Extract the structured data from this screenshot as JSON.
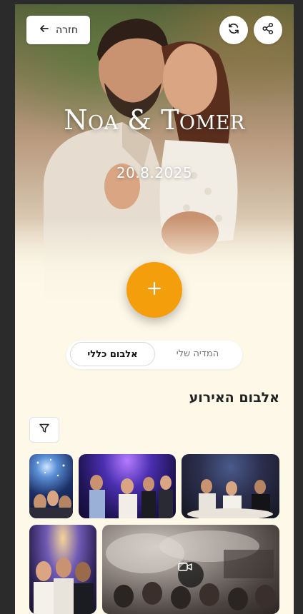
{
  "header": {
    "back_label": "חזרה",
    "back_icon": "arrow-left-icon",
    "share_icon": "share-icon",
    "refresh_icon": "refresh-icon"
  },
  "hero": {
    "title": "Noa & Tomer",
    "date": "20.8.2025"
  },
  "fab": {
    "icon": "plus-icon",
    "color": "#f59e0b"
  },
  "tabs": {
    "general": "אלבום כללי",
    "mine": "המדיה שלי",
    "active": "general"
  },
  "section": {
    "title": "אלבום האירוע",
    "filter_icon": "filter-icon"
  },
  "gallery": {
    "items": [
      {
        "type": "photo"
      },
      {
        "type": "photo"
      },
      {
        "type": "photo"
      },
      {
        "type": "photo"
      },
      {
        "type": "video",
        "badge_icon": "video-camera-icon"
      }
    ]
  },
  "colors": {
    "background": "#fdf8e8",
    "accent": "#f59e0b",
    "text": "#222222"
  }
}
